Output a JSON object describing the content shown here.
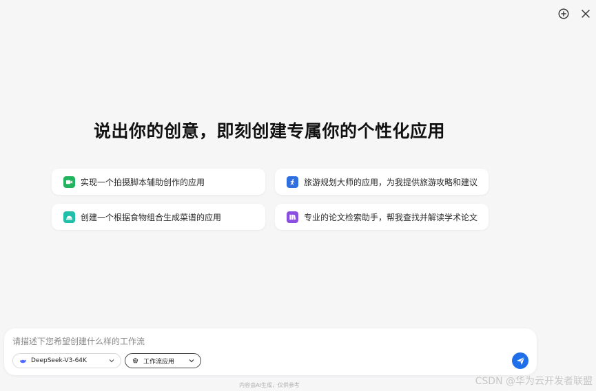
{
  "header": {
    "new_chat_icon": "plus-circle-icon",
    "close_icon": "close-icon"
  },
  "headline": "说出你的创意，即刻创建专属你的个性化应用",
  "suggestions": [
    {
      "label": "实现一个拍摄脚本辅助创作的应用",
      "icon": "video-camera-icon",
      "color": "#22b35e"
    },
    {
      "label": "旅游规划大师的应用，为我提供旅游攻略和建议",
      "icon": "walking-person-icon",
      "color": "#2f6fe0"
    },
    {
      "label": "创建一个根据食物组合生成菜谱的应用",
      "icon": "food-dome-icon",
      "color": "#20bfa9"
    },
    {
      "label": "专业的论文检索助手，帮我查找并解读学术论文",
      "icon": "books-icon",
      "color": "#8a4fe0"
    }
  ],
  "composer": {
    "placeholder": "请描述下您希望创建什么样的工作流",
    "model_label": "DeepSeek-V3-64K",
    "app_label": "工作流应用",
    "send_icon": "paper-plane-icon",
    "accent": "#1f6feb"
  },
  "disclaimer": "内容由AI生成，仅供参考",
  "watermark": "CSDN @华为云开发者联盟"
}
